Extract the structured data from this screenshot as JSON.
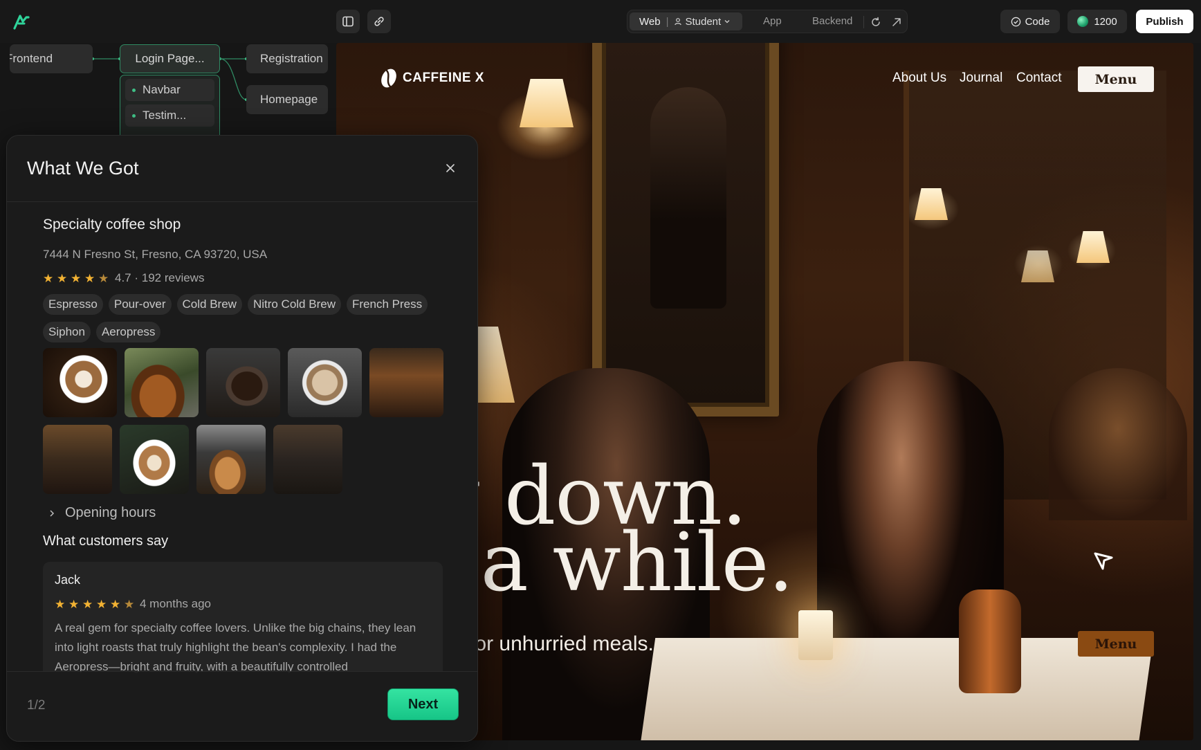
{
  "topbar": {
    "logo_icon": "builder-logo-icon",
    "sidebar_toggle_icon": "sidebar-icon",
    "link_icon": "link-icon",
    "tabs": {
      "web": "Web",
      "student": "Student",
      "app": "App",
      "backend": "Backend"
    },
    "code_label": "Code",
    "credits": "1200",
    "publish_label": "Publish"
  },
  "flow": {
    "frontend": "Frontend",
    "login": "Login Page...",
    "registration": "Registration",
    "homepage": "Homepage",
    "children": [
      "Navbar",
      "Testim..."
    ]
  },
  "site": {
    "brand": "CAFFEINE X",
    "nav": [
      "About Us",
      "Journal",
      "Contact"
    ],
    "menu_label": "Menu",
    "headline_line1": "ow down.",
    "headline_line2": "ay a while.",
    "subline": "ay place for unhurried meals.",
    "menu_label_2": "Menu"
  },
  "panel": {
    "title": "What We Got",
    "shop_name": "Specialty coffee shop",
    "address": "7444 N Fresno St, Fresno, CA 93720, USA",
    "rating_value": 4.7,
    "rating_text": "4.7 · 192 reviews",
    "tags": [
      "Espresso",
      "Pour-over",
      "Cold Brew",
      "Nitro Cold Brew",
      "French Press",
      "Siphon",
      "Aeropress"
    ],
    "opening_hours": "Opening hours",
    "customers_heading": "What customers say",
    "review": {
      "name": "Jack",
      "stars": 5,
      "time": "4 months ago",
      "text": "A real gem for specialty coffee lovers. Unlike the big chains, they lean into light roasts that truly highlight the bean's complexity. I had the Aeropress—bright and fruity, with a beautifully controlled"
    },
    "pager": "1/2",
    "next_label": "Next"
  },
  "colors": {
    "accent_green": "#1fd391",
    "star_gold": "#f2b233",
    "publish_bg": "#ffffff"
  }
}
